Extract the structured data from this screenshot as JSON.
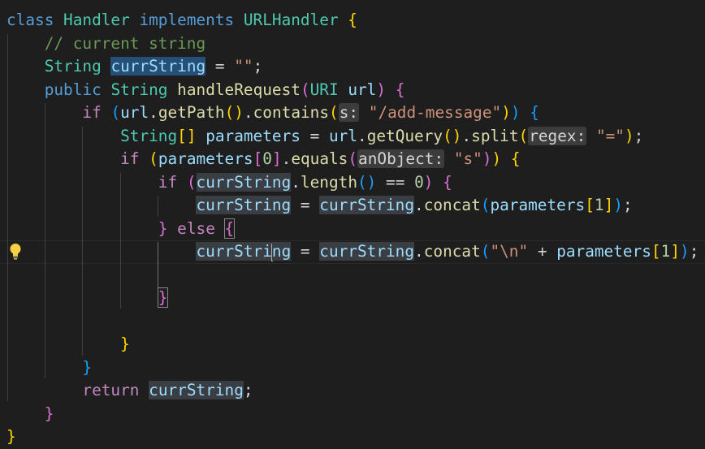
{
  "editor": {
    "language": "java",
    "lines": [
      [
        [
          "class ",
          "kw"
        ],
        [
          "Handler ",
          "type"
        ],
        [
          "implements ",
          "kw"
        ],
        [
          "URLHandler ",
          "type"
        ],
        [
          "{",
          "b1"
        ]
      ],
      [
        [
          "    // current string",
          "cmt"
        ]
      ],
      [
        [
          "    ",
          ""
        ],
        [
          "String ",
          "type"
        ],
        [
          "currString",
          "var hl-sel"
        ],
        [
          " = ",
          ""
        ],
        [
          "\"\"",
          "str"
        ],
        [
          ";",
          ""
        ]
      ],
      [
        [
          "    ",
          ""
        ],
        [
          "public ",
          "kw"
        ],
        [
          "String ",
          "type"
        ],
        [
          "handleRequest",
          "fn"
        ],
        [
          "(",
          "b2"
        ],
        [
          "URI ",
          "type"
        ],
        [
          "url",
          "var"
        ],
        [
          ")",
          "b2"
        ],
        [
          " ",
          ""
        ],
        [
          "{",
          "b2"
        ]
      ],
      [
        [
          "        ",
          ""
        ],
        [
          "if ",
          "ctl"
        ],
        [
          "(",
          "b3"
        ],
        [
          "url",
          "var"
        ],
        [
          ".",
          ""
        ],
        [
          "getPath",
          "fn"
        ],
        [
          "()",
          "b1"
        ],
        [
          ".",
          ""
        ],
        [
          "contains",
          "fn"
        ],
        [
          "(",
          "b1"
        ],
        [
          "s:",
          "hint"
        ],
        [
          " ",
          ""
        ],
        [
          "\"/add-message\"",
          "str"
        ],
        [
          ")",
          "b1"
        ],
        [
          ")",
          "b3"
        ],
        [
          " ",
          ""
        ],
        [
          "{",
          "b3"
        ]
      ],
      [
        [
          "            ",
          ""
        ],
        [
          "String",
          "type"
        ],
        [
          "[]",
          "b1"
        ],
        [
          " ",
          ""
        ],
        [
          "parameters",
          "var"
        ],
        [
          " = ",
          ""
        ],
        [
          "url",
          "var"
        ],
        [
          ".",
          ""
        ],
        [
          "getQuery",
          "fn"
        ],
        [
          "()",
          "b1"
        ],
        [
          ".",
          ""
        ],
        [
          "split",
          "fn"
        ],
        [
          "(",
          "b1"
        ],
        [
          "regex:",
          "hint"
        ],
        [
          " ",
          ""
        ],
        [
          "\"=\"",
          "str"
        ],
        [
          ")",
          "b1"
        ],
        [
          ";",
          ""
        ]
      ],
      [
        [
          "            ",
          ""
        ],
        [
          "if ",
          "ctl"
        ],
        [
          "(",
          "b1"
        ],
        [
          "parameters",
          "var"
        ],
        [
          "[",
          "b2"
        ],
        [
          "0",
          "num"
        ],
        [
          "]",
          "b2"
        ],
        [
          ".",
          ""
        ],
        [
          "equals",
          "fn"
        ],
        [
          "(",
          "b2"
        ],
        [
          "anObject:",
          "hint"
        ],
        [
          " ",
          ""
        ],
        [
          "\"s\"",
          "str"
        ],
        [
          ")",
          "b2"
        ],
        [
          ")",
          "b1"
        ],
        [
          " ",
          ""
        ],
        [
          "{",
          "b1"
        ]
      ],
      [
        [
          "                ",
          ""
        ],
        [
          "if ",
          "ctl"
        ],
        [
          "(",
          "b2"
        ],
        [
          "currString",
          "var hl"
        ],
        [
          ".",
          ""
        ],
        [
          "length",
          "fn"
        ],
        [
          "()",
          "b3"
        ],
        [
          " == ",
          ""
        ],
        [
          "0",
          "num"
        ],
        [
          ")",
          "b2"
        ],
        [
          " ",
          ""
        ],
        [
          "{",
          "b2"
        ]
      ],
      [
        [
          "                    ",
          ""
        ],
        [
          "currString",
          "var hl"
        ],
        [
          " = ",
          ""
        ],
        [
          "currString",
          "var hl"
        ],
        [
          ".",
          ""
        ],
        [
          "concat",
          "fn"
        ],
        [
          "(",
          "b3"
        ],
        [
          "parameters",
          "var"
        ],
        [
          "[",
          "b1"
        ],
        [
          "1",
          "num"
        ],
        [
          "]",
          "b1"
        ],
        [
          ")",
          "b3"
        ],
        [
          ";",
          ""
        ]
      ],
      [
        [
          "                ",
          ""
        ],
        [
          "}",
          "b2"
        ],
        [
          " ",
          ""
        ],
        [
          "else ",
          "ctl"
        ],
        [
          "{",
          "b2 bracket-box"
        ]
      ],
      [
        [
          "                    ",
          ""
        ],
        [
          "currStri",
          "var hl"
        ],
        [
          "|",
          "cursor"
        ],
        [
          "ng",
          "var hl"
        ],
        [
          " = ",
          ""
        ],
        [
          "currString",
          "var hl"
        ],
        [
          ".",
          ""
        ],
        [
          "concat",
          "fn"
        ],
        [
          "(",
          "b3"
        ],
        [
          "\"\\n\"",
          "str"
        ],
        [
          " + ",
          ""
        ],
        [
          "parameters",
          "var"
        ],
        [
          "[",
          "b1"
        ],
        [
          "1",
          "num"
        ],
        [
          "]",
          "b1"
        ],
        [
          ")",
          "b3"
        ],
        [
          ";",
          ""
        ]
      ],
      [
        [
          "",
          ""
        ]
      ],
      [
        [
          "                ",
          ""
        ],
        [
          "}",
          "b2 bracket-box"
        ]
      ],
      [
        [
          "",
          ""
        ]
      ],
      [
        [
          "            ",
          ""
        ],
        [
          "}",
          "b1"
        ]
      ],
      [
        [
          "        ",
          ""
        ],
        [
          "}",
          "b3"
        ]
      ],
      [
        [
          "        ",
          ""
        ],
        [
          "return ",
          "ctl"
        ],
        [
          "currString",
          "var hl"
        ],
        [
          ";",
          ""
        ]
      ],
      [
        [
          "    ",
          ""
        ],
        [
          "}",
          "b2"
        ]
      ],
      [
        [
          "}",
          "b1"
        ]
      ]
    ],
    "lightbulb": "lightbulb-icon"
  }
}
